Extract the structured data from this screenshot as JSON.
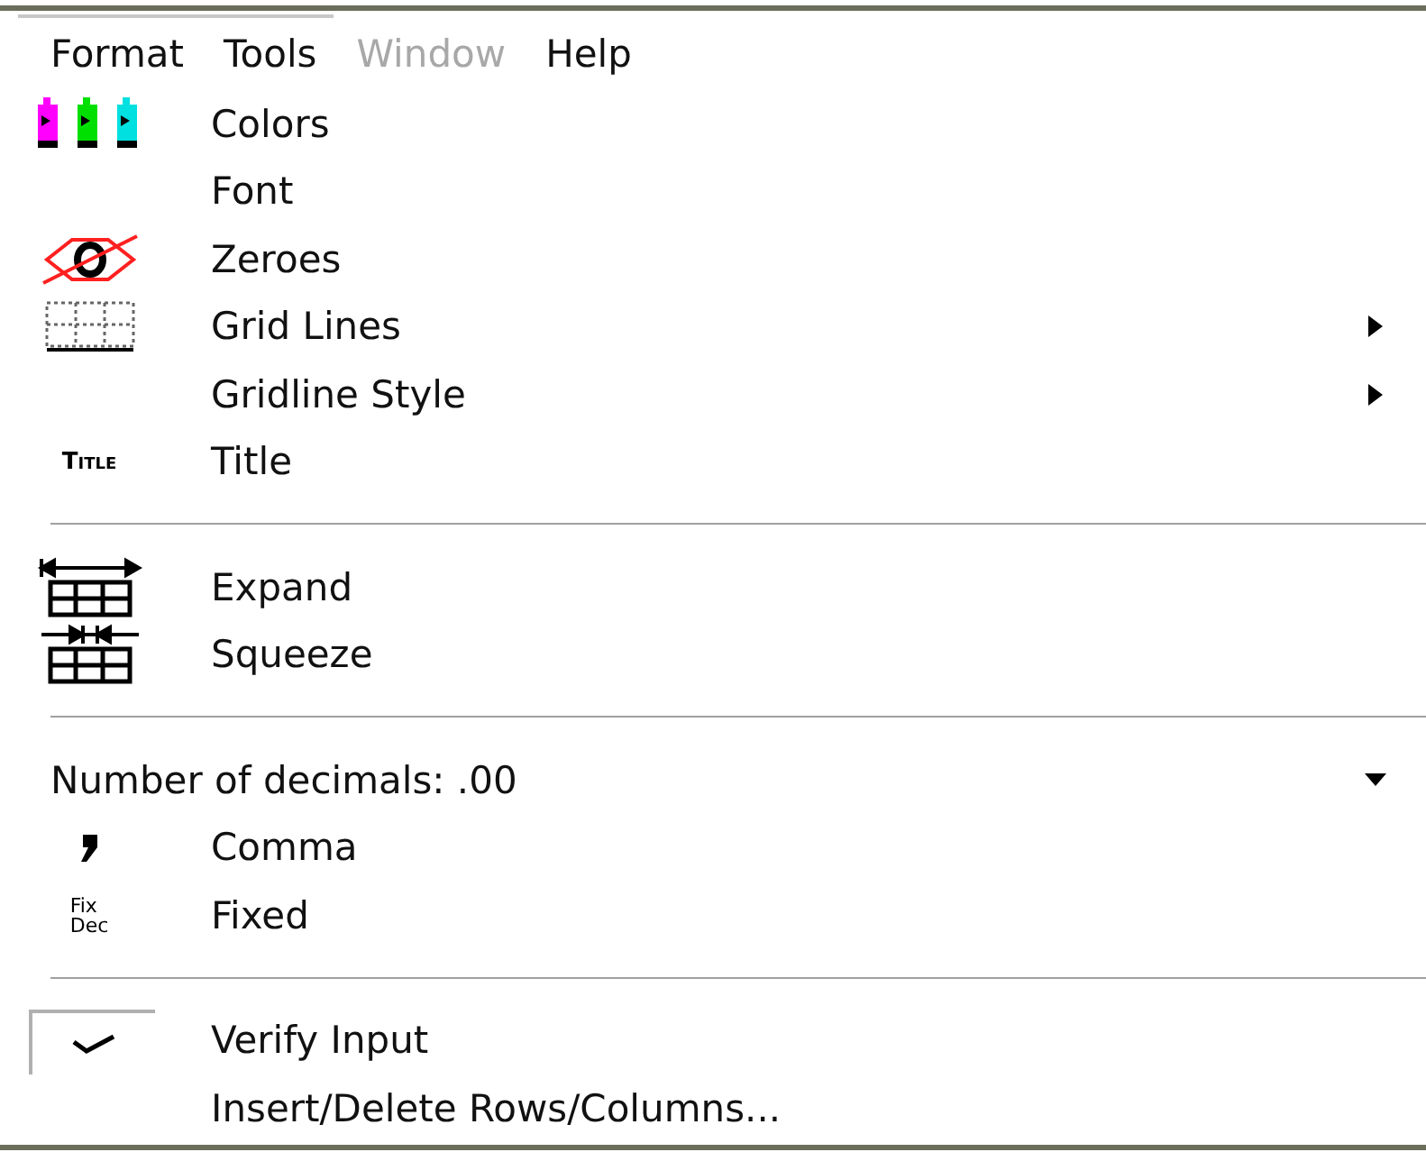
{
  "menubar": [
    {
      "label": "Format",
      "disabled": false
    },
    {
      "label": "Tools",
      "disabled": false
    },
    {
      "label": "Window",
      "disabled": true
    },
    {
      "label": "Help",
      "disabled": false
    }
  ],
  "menu": [
    {
      "kind": "item",
      "label": "Colors"
    },
    {
      "kind": "item",
      "label": "Font"
    },
    {
      "kind": "item",
      "label": "Zeroes"
    },
    {
      "kind": "item",
      "label": "Grid Lines",
      "submenu": true
    },
    {
      "kind": "item",
      "label": "Gridline Style",
      "submenu": true
    },
    {
      "kind": "item",
      "label": "Title",
      "icon_text": "Title"
    },
    {
      "kind": "separator"
    },
    {
      "kind": "item",
      "label": "Expand"
    },
    {
      "kind": "item",
      "label": "Squeeze"
    },
    {
      "kind": "separator"
    },
    {
      "kind": "dropdown",
      "label": "Number of decimals: .00"
    },
    {
      "kind": "item",
      "label": "Comma"
    },
    {
      "kind": "item",
      "label": "Fixed",
      "icon_lines": [
        "Fix",
        "Dec"
      ]
    },
    {
      "kind": "separator"
    },
    {
      "kind": "check",
      "label": "Verify Input",
      "checked": true
    },
    {
      "kind": "item",
      "label": "Insert/Delete Rows/Columns..."
    }
  ]
}
